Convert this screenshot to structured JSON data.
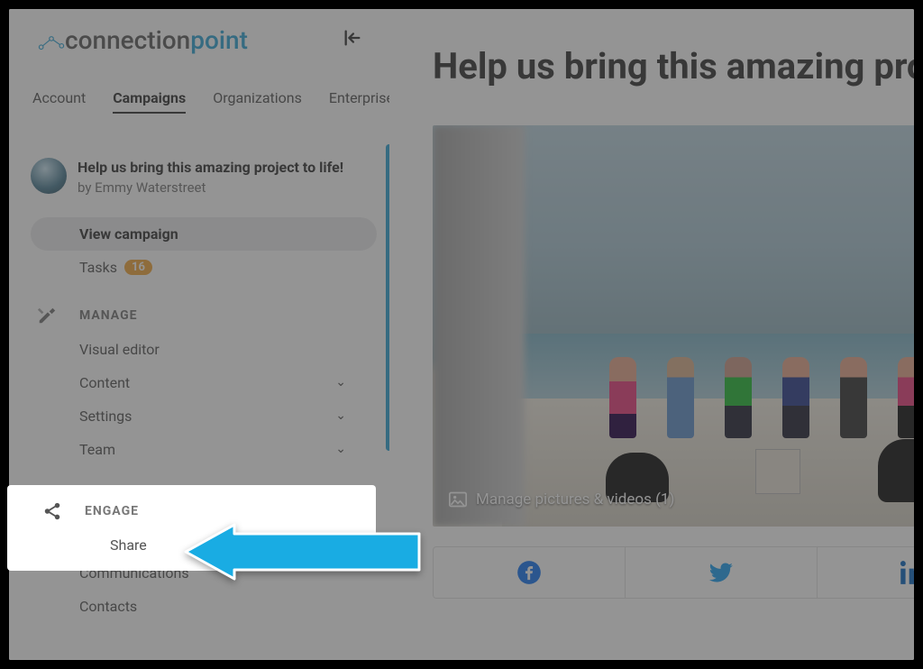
{
  "logo": {
    "word1": "connection",
    "word2": "point"
  },
  "nav": {
    "account": "Account",
    "campaigns": "Campaigns",
    "organizations": "Organizations",
    "enterprise": "Enterprise"
  },
  "campaign": {
    "title": "Help us bring this amazing project to life!",
    "byline_prefix": "by ",
    "byline_name": "Emmy Waterstreet"
  },
  "sidebar": {
    "view_campaign": "View campaign",
    "tasks": "Tasks",
    "tasks_badge": "16",
    "manage_header": "MANAGE",
    "visual_editor": "Visual editor",
    "content": "Content",
    "settings": "Settings",
    "team": "Team",
    "engage_header": "ENGAGE",
    "share": "Share",
    "communications": "Communications",
    "contacts": "Contacts"
  },
  "main": {
    "title": "Help us bring this amazing project to life!",
    "manage_media": "Manage pictures & videos (1)"
  },
  "colors": {
    "brand_blue": "#2fa4d6",
    "facebook": "#1877f2",
    "twitter": "#1da1f2",
    "linkedin": "#0a66c2",
    "arrow": "#19ace3"
  }
}
